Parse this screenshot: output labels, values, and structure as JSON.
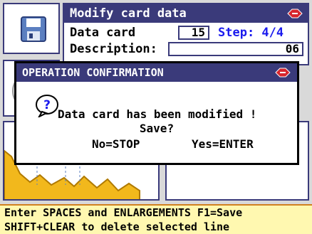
{
  "header": {
    "title": "Modify card data"
  },
  "fields": {
    "data_card_label": "Data card",
    "data_card_value": "15",
    "step_label": "Step: 4/4",
    "description_label": "Description:",
    "description_value": "06"
  },
  "dialog": {
    "title": "OPERATION CONFIRMATION",
    "message_line1": "Data card has been modified !",
    "message_line2": "Save?",
    "option_no": "No=STOP",
    "option_yes": "Yes=ENTER"
  },
  "footer": {
    "line1": "Enter SPACES and ENLARGEMENTS F1=Save",
    "line2": "SHIFT+CLEAR to delete selected line"
  },
  "icons": [
    "floppy-disk-icon",
    "brand-logo-icon",
    "question-icon",
    "key-profile-icon"
  ],
  "colors": {
    "header_bg": "#3a3a7a",
    "step_text": "#1a1aee",
    "footer_bg": "#fff8b0",
    "footer_border": "#d08020",
    "key_fill": "#f2b81c"
  }
}
